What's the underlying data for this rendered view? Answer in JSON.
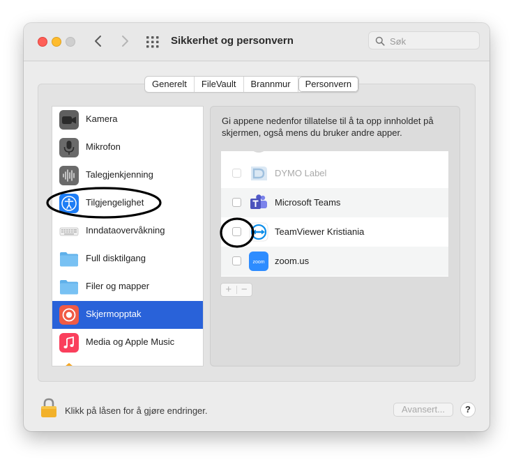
{
  "window": {
    "title": "Sikkerhet og personvern",
    "search_placeholder": "Søk"
  },
  "toolbar": {
    "back_icon": "chevron-left-icon",
    "forward_icon": "chevron-right-icon",
    "grid_icon": "grid-icon"
  },
  "tabs": [
    {
      "label": "Generelt",
      "active": false
    },
    {
      "label": "FileVault",
      "active": false
    },
    {
      "label": "Brannmur",
      "active": false
    },
    {
      "label": "Personvern",
      "active": true
    }
  ],
  "categories": [
    {
      "label": "Kamera",
      "icon": "camera-icon",
      "selected": false
    },
    {
      "label": "Mikrofon",
      "icon": "microphone-icon",
      "selected": false
    },
    {
      "label": "Talegjenkjenning",
      "icon": "waveform-icon",
      "selected": false
    },
    {
      "label": "Tilgjengelighet",
      "icon": "accessibility-icon",
      "selected": false
    },
    {
      "label": "Inndataovervåkning",
      "icon": "keyboard-icon",
      "selected": false
    },
    {
      "label": "Full disktilgang",
      "icon": "folder-icon",
      "selected": false
    },
    {
      "label": "Filer og mapper",
      "icon": "folder-icon",
      "selected": false
    },
    {
      "label": "Skjermopptak",
      "icon": "screen-record-icon",
      "selected": true
    },
    {
      "label": "Media og Apple Music",
      "icon": "music-icon",
      "selected": false
    }
  ],
  "panel": {
    "description": "Gi appene nedenfor tillatelse til å ta opp innholdet på skjermen, også mens du bruker andre apper.",
    "apps": [
      {
        "name": "DYMO Label",
        "checked": false,
        "enabled": false,
        "icon": "dymo-label-icon"
      },
      {
        "name": "Microsoft Teams",
        "checked": false,
        "enabled": true,
        "icon": "teams-icon"
      },
      {
        "name": "TeamViewer Kristiania",
        "checked": false,
        "enabled": true,
        "icon": "teamviewer-icon"
      },
      {
        "name": "zoom.us",
        "checked": false,
        "enabled": true,
        "icon": "zoom-icon"
      }
    ],
    "add_label": "+",
    "remove_label": "−",
    "zoom_icon_text": "zoom"
  },
  "footer": {
    "lock_text": "Klikk på låsen for å gjøre endringer.",
    "advanced_label": "Avansert...",
    "help_label": "?"
  },
  "colors": {
    "selection": "#2962d9",
    "annotation_circles": "#000000"
  }
}
